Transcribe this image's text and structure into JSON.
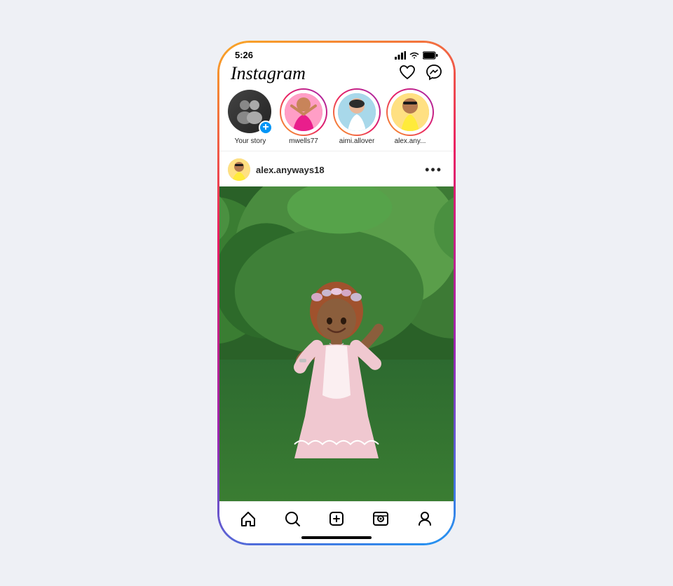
{
  "phone": {
    "status_bar": {
      "time": "5:26"
    },
    "header": {
      "logo": "Instagram",
      "heart_icon": "♡",
      "messenger_icon": "✉"
    },
    "stories": [
      {
        "id": "your-story",
        "label": "Your story",
        "has_add": true,
        "avatar_type": "your"
      },
      {
        "id": "mwells77",
        "label": "mwells77",
        "has_add": false,
        "avatar_type": "pink"
      },
      {
        "id": "aimi.allover",
        "label": "aimi.allover",
        "has_add": false,
        "avatar_type": "blue"
      },
      {
        "id": "alex.any...",
        "label": "alex.any...",
        "has_add": false,
        "avatar_type": "yellow"
      }
    ],
    "post": {
      "username": "alex.anyways18",
      "more_icon": "•••"
    },
    "bottom_nav": {
      "items": [
        {
          "id": "home",
          "icon": "⌂",
          "active": true
        },
        {
          "id": "search",
          "icon": "⊙",
          "active": false
        },
        {
          "id": "create",
          "icon": "⊕",
          "active": false
        },
        {
          "id": "reels",
          "icon": "▷",
          "active": false
        },
        {
          "id": "profile",
          "icon": "◯",
          "active": false
        }
      ]
    }
  }
}
